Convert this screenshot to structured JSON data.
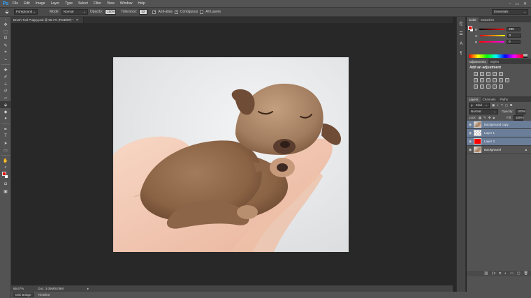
{
  "app": {
    "logo": "Ps"
  },
  "menu": [
    "File",
    "Edit",
    "Image",
    "Layer",
    "Type",
    "Select",
    "Filter",
    "View",
    "Window",
    "Help"
  ],
  "window_controls": [
    "–",
    "▭",
    "✕"
  ],
  "options": {
    "fill_source": "Foreground",
    "mode_label": "Mode:",
    "mode_value": "Normal",
    "opacity_label": "Opacity:",
    "opacity_value": "100%",
    "tolerance_label": "Tolerance:",
    "tolerance_value": "32",
    "antialias_label": "Anti-alias",
    "contiguous_label": "Contiguous",
    "all_layers_label": "All Layers",
    "workspace": "Essentials"
  },
  "document": {
    "tab_title": "Brush Tool Puppy.psd @ 66.7% (RGB/8#) *",
    "zoom": "66.67%",
    "doc_size": "Doc: 3.09M/8.09M"
  },
  "bottom_tabs": [
    "Mini Bridge",
    "Timeline"
  ],
  "color_panel": {
    "tabs": [
      "Color",
      "Swatches"
    ],
    "sliders": [
      {
        "label": "R",
        "value": "255",
        "gradient": "linear-gradient(90deg,#000,#ff0000)"
      },
      {
        "label": "G",
        "value": "0",
        "gradient": "linear-gradient(90deg,#ff0000,#ffff00)"
      },
      {
        "label": "B",
        "value": "0",
        "gradient": "linear-gradient(90deg,#ff0000,#ff00ff)"
      }
    ],
    "fg": "#e01010",
    "bg": "#ffffff"
  },
  "adjustments_panel": {
    "tabs": [
      "Adjustments",
      "Styles"
    ],
    "title": "Add an adjustment"
  },
  "layers_panel": {
    "tabs": [
      "Layers",
      "Channels",
      "Paths"
    ],
    "kind_filter": "Kind",
    "blend_mode": "Normal",
    "opacity_label": "Opacity:",
    "opacity_value": "100%",
    "lock_label": "Lock:",
    "fill_label": "Fill:",
    "fill_value": "100%",
    "layers": [
      {
        "name": "Background copy",
        "thumb": "photo",
        "selected": true
      },
      {
        "name": "Layer 1",
        "thumb": "transparent",
        "selected": true
      },
      {
        "name": "Layer 2",
        "thumb": "red",
        "selected": true
      },
      {
        "name": "Background",
        "thumb": "photo",
        "selected": false,
        "locked": true
      }
    ]
  }
}
